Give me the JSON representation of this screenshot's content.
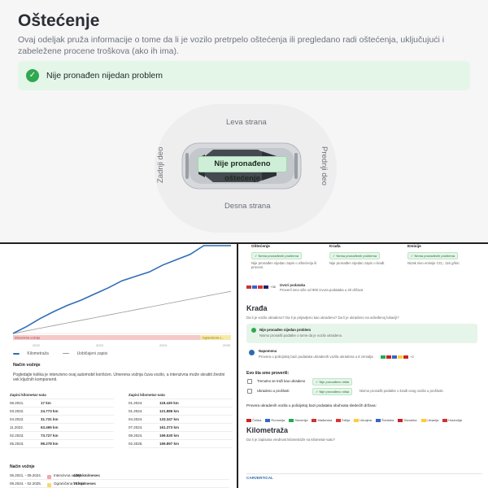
{
  "top": {
    "title": "Oštećenje",
    "description": "Ovaj odeljak pruža informacije o tome da li je vozilo pretrpelo oštećenja ili pregledano radi oštećenja, uključujući i zabeležene procene troškova (ako ih ima).",
    "banner_text": "Nije pronađen nijedan problem",
    "car": {
      "left_side": "Leva strana",
      "right_side": "Desna strana",
      "rear": "Zadnji deo",
      "front": "Prednji deo",
      "status": "Nije pronađeno oštećenje"
    }
  },
  "left_panel": {
    "chart_data": {
      "type": "line",
      "x_ticks": [
        "2022",
        "2023",
        "2024",
        "2025"
      ],
      "series": [
        {
          "name": "Kilometraža",
          "color": "#2f6fb3",
          "values": [
            0,
            8,
            17,
            25,
            32,
            38,
            45,
            52,
            60,
            65,
            70,
            78,
            84,
            90,
            100,
            100,
            100
          ]
        },
        {
          "name": "Uobičajeni zapisi",
          "color": "#9a9a9a",
          "values": [
            0,
            3,
            6,
            9,
            12,
            15,
            18,
            21,
            24,
            27,
            30,
            33,
            36,
            39,
            42,
            45,
            48
          ]
        }
      ],
      "bands": [
        "Intenzivna vožnja",
        "Ograničena v..."
      ]
    },
    "section_heading": "Način vožnje",
    "section_text": "Pogledajte kolika je intenzivno ovaj automobil korišćen. Umerena vožnja čuva vozilo, a intenzivna može skratiti životni vek ključnih komponenti.",
    "table_left_header": [
      "Zapisi kilometar-sata",
      ""
    ],
    "table_left": [
      [
        "06.2021.",
        "17 km"
      ],
      [
        "03.2022.",
        "24.773 km"
      ],
      [
        "04.2022.",
        "31.731 km"
      ],
      [
        "11.2022.",
        "63.465 km"
      ],
      [
        "02.2023.",
        "73.727 km"
      ],
      [
        "05.2023.",
        "98.278 km"
      ]
    ],
    "table_right_header": [
      "Zapisi kilometar-sata",
      ""
    ],
    "table_right": [
      [
        "01.2024.",
        "118.430 km"
      ],
      [
        "01.2024.",
        "121.886 km"
      ],
      [
        "04.2024.",
        "133.347 km"
      ],
      [
        "07.2024.",
        "161.373 km"
      ],
      [
        "09.2024.",
        "169.530 km"
      ],
      [
        "02.2025.",
        "169.897 km"
      ]
    ],
    "driving_heading": "Način vožnje",
    "driving_rows": [
      {
        "range": "06.2021. - 09.2024.",
        "label": "Intenzivna vožnja",
        "value": "4490 km/mesec",
        "color": "#f4a5a5"
      },
      {
        "range": "09.2024. - 02.2025.",
        "label": "Ograničena vožnja",
        "value": "73 km/mesec",
        "color": "#f5d96b"
      }
    ]
  },
  "right_panel": {
    "cards": [
      {
        "title": "Oštećenje",
        "badge": "Nema pronađenih problema",
        "text": "Nije pronađen nijedan zapis o oštećenju ili proceni."
      },
      {
        "title": "Krađa",
        "badge": "Nema pronađenih problema",
        "text": "Nije pronađen nijedan zapis o krađi."
      },
      {
        "title": "Emisije",
        "badge": "Nema pronađenih problema",
        "text": "Nizak nivo emisije CO₂: 116 g/km."
      }
    ],
    "sources_title": "Izvori podataka",
    "sources_text": "Proveril smo više od 900 izvora podataka u 40 država",
    "sources_count": "+36",
    "theft_title": "Krađa",
    "theft_question": "Da li je vozilo ukradeno? Da li je prijavljeno kao ukradeno? Da li je ukradeno na određenoj lokaciji?",
    "theft_ok_title": "Nije pronađen nijedan problem",
    "theft_ok_text": "Nismo pronašli podatke o tome da je vozilo ukradeno.",
    "theft_reminder_title": "Napomena",
    "theft_reminder_text": "Provera u policijskoj bazi podataka ukradenih vozila ukradena u 8 zemalja",
    "theft_flags_more": "+2",
    "checks_title": "Evo šta smo proverili:",
    "checks": [
      {
        "label": "Trenutno se traži kao ukradeno",
        "badge": "Nije pronađeno ništa"
      },
      {
        "label": "Ukradeno u prošlosti",
        "badge": "Nije pronađeno ništa"
      }
    ],
    "checks_note": "Nismo pronašli podatke o krađi ovog vozila u prošlosti.",
    "countries_title": "Provera ukradenih vozila u policijskoj bazi podataka obuhvata sledećih država:",
    "countries": [
      "Češka",
      "Rumunija",
      "Slovenija",
      "Mađarska",
      "Srbija",
      "Ukrajina",
      "Švedska",
      "Slovačka",
      "Litvanija",
      "Holandija"
    ],
    "km_title": "Kilometraža",
    "km_question": "Da li je zapisana vrednost kilometraže na kilometar-satu?",
    "footer_logo": "CARVERTICAL"
  }
}
